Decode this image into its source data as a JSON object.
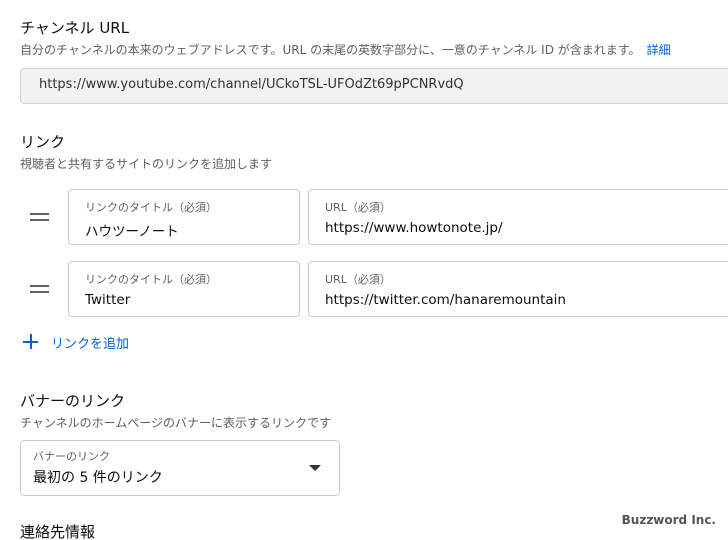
{
  "channel_url": {
    "title": "チャンネル URL",
    "description": "自分のチャンネルの本来のウェブアドレスです。URL の末尾の英数字部分に、一意のチャンネル ID が含まれます。",
    "details_link": "詳細",
    "value": "https://www.youtube.com/channel/UCkoTSL-UFOdZt69pPCNRvdQ"
  },
  "links": {
    "title": "リンク",
    "description": "視聴者と共有するサイトのリンクを追加します",
    "items": [
      {
        "title_label": "リンクのタイトル（必須）",
        "title_value": "ハウツーノート",
        "url_label": "URL（必須）",
        "url_value": "https://www.howtonote.jp/"
      },
      {
        "title_label": "リンクのタイトル（必須）",
        "title_value": "Twitter",
        "url_label": "URL（必須）",
        "url_value": "https://twitter.com/hanaremountain"
      }
    ],
    "add_label": "リンクを追加"
  },
  "banner_links": {
    "title": "バナーのリンク",
    "description": "チャンネルのホームページのバナーに表示するリンクです",
    "select_label": "バナーのリンク",
    "select_value": "最初の 5 件のリンク"
  },
  "contact": {
    "title": "連絡先情報"
  },
  "watermark": "Buzzword Inc.",
  "colors": {
    "accent": "#065fd4",
    "secondary_text": "#606060",
    "border": "#cccccc"
  }
}
